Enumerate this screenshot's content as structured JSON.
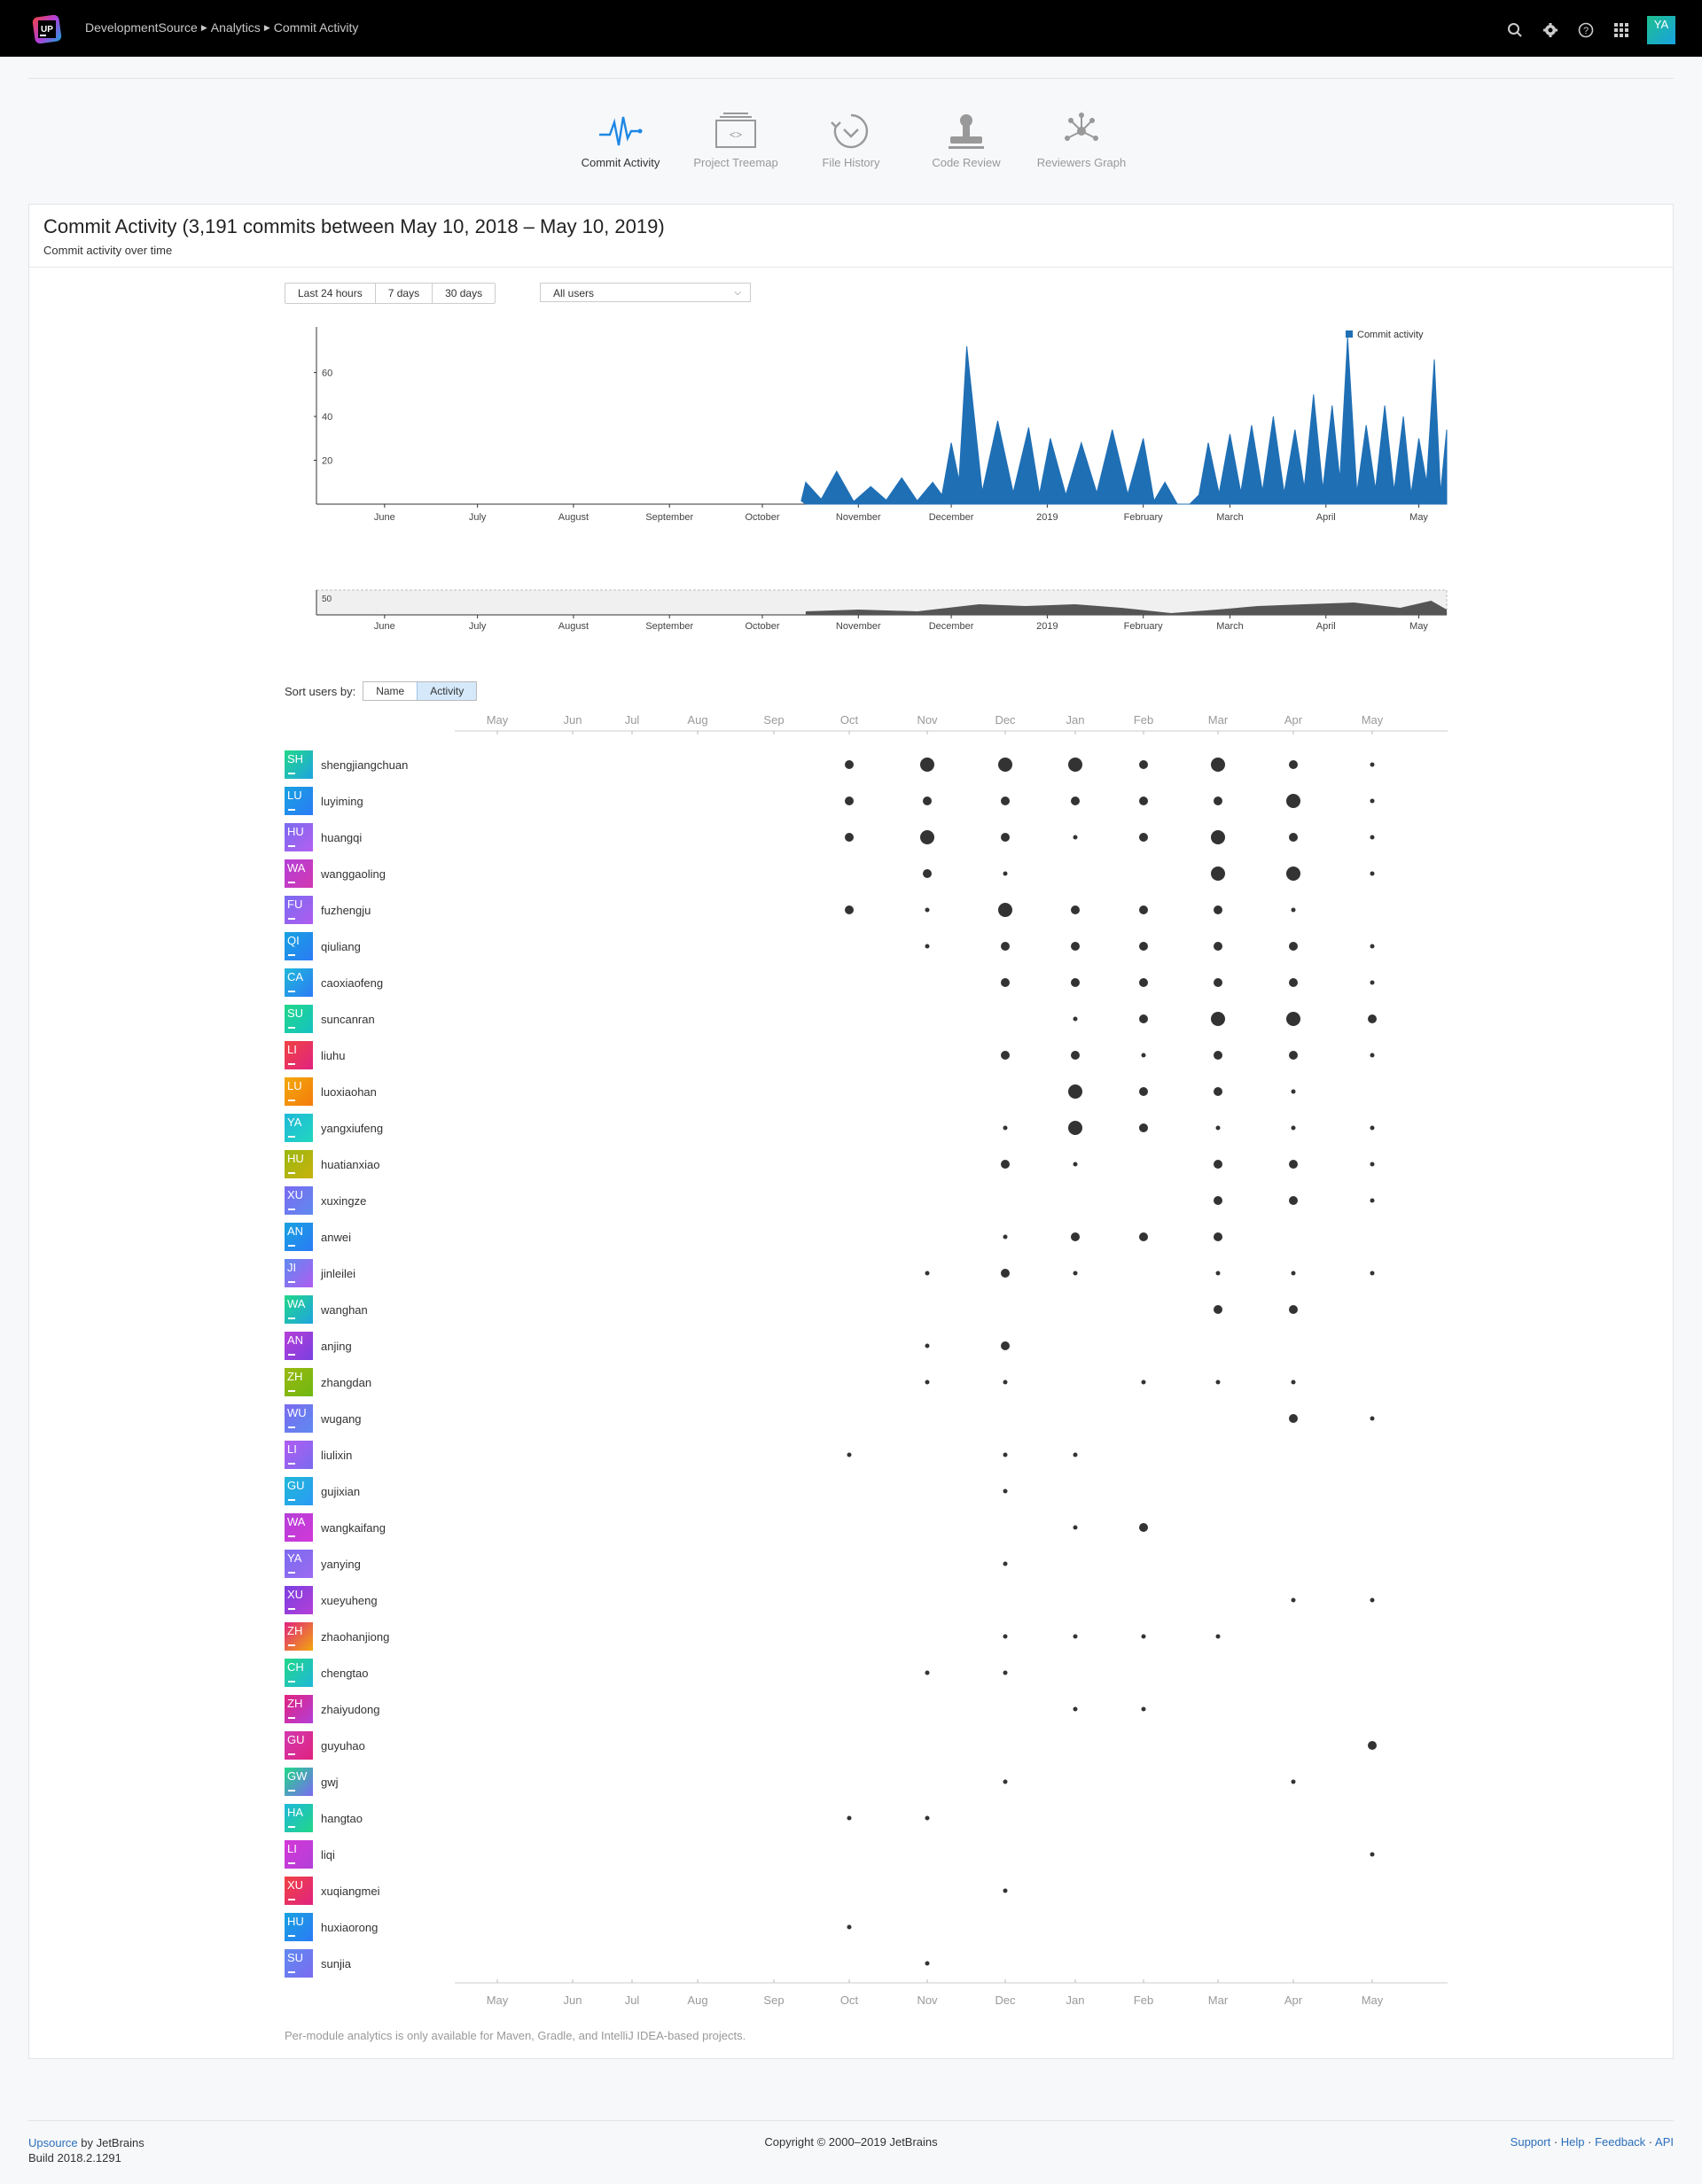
{
  "topbar": {
    "logo": "UP",
    "breadcrumb": [
      "DevelopmentSource",
      "Analytics",
      "Commit Activity"
    ],
    "icons": [
      "search-icon",
      "settings-icon",
      "help-icon",
      "apps-grid-icon"
    ],
    "user_avatar": "YA"
  },
  "tools": [
    {
      "label": "Commit Activity",
      "icon": "pulse-icon",
      "active": true
    },
    {
      "label": "Project Treemap",
      "icon": "treemap-icon",
      "active": false
    },
    {
      "label": "File History",
      "icon": "history-icon",
      "active": false
    },
    {
      "label": "Code Review",
      "icon": "stamp-icon",
      "active": false
    },
    {
      "label": "Reviewers Graph",
      "icon": "graph-icon",
      "active": false
    }
  ],
  "card": {
    "title": "Commit Activity (3,191 commits between May 10, 2018 – May 10, 2019)",
    "subtitle": "Commit activity over time",
    "ranges": [
      "Last 24 hours",
      "7 days",
      "30 days"
    ],
    "user_filter": "All users"
  },
  "chart_data": [
    {
      "type": "area",
      "legend": "Commit activity",
      "legend_position": "top-right",
      "yticks": [
        20,
        40,
        60
      ],
      "ylim": [
        0,
        78
      ],
      "x_labels": [
        "June",
        "July",
        "August",
        "September",
        "October",
        "November",
        "December",
        "2019",
        "February",
        "March",
        "April",
        "May"
      ],
      "x_range": [
        "2018-05-10",
        "2019-05-10"
      ],
      "x": [
        "2018-10-15",
        "2018-10-25",
        "2018-11-05",
        "2018-11-15",
        "2018-11-25",
        "2018-12-01",
        "2018-12-06",
        "2018-12-16",
        "2018-12-26",
        "2019-01-02",
        "2019-01-12",
        "2019-01-22",
        "2019-02-01",
        "2019-02-08",
        "2019-02-16",
        "2019-02-22",
        "2019-03-01",
        "2019-03-08",
        "2019-03-15",
        "2019-03-22",
        "2019-03-28",
        "2019-04-03",
        "2019-04-08",
        "2019-04-14",
        "2019-04-20",
        "2019-04-26",
        "2019-05-01",
        "2019-05-06",
        "2019-05-10"
      ],
      "values": [
        10,
        15,
        8,
        12,
        10,
        28,
        72,
        38,
        35,
        30,
        28,
        34,
        30,
        10,
        0,
        28,
        32,
        36,
        40,
        34,
        50,
        45,
        76,
        36,
        45,
        40,
        30,
        66,
        34
      ],
      "grid": false
    },
    {
      "type": "area",
      "role": "overview",
      "yticks": [
        50
      ],
      "x_labels": [
        "June",
        "July",
        "August",
        "September",
        "October",
        "November",
        "December",
        "2019",
        "February",
        "March",
        "April",
        "May"
      ],
      "x": [
        "2018-10-15",
        "2018-11-01",
        "2018-11-20",
        "2018-12-10",
        "2018-12-25",
        "2019-01-10",
        "2019-01-25",
        "2019-02-10",
        "2019-02-25",
        "2019-03-10",
        "2019-03-25",
        "2019-04-10",
        "2019-04-25",
        "2019-05-05",
        "2019-05-10"
      ],
      "values": [
        2,
        3,
        2,
        6,
        5,
        6,
        4,
        1,
        3,
        5,
        6,
        7,
        4,
        8,
        3
      ]
    },
    {
      "type": "scatter",
      "role": "per-user bubbles",
      "months": [
        "May",
        "Jun",
        "Jul",
        "Aug",
        "Sep",
        "Oct",
        "Nov",
        "Dec",
        "Jan",
        "Feb",
        "Mar",
        "Apr",
        "May"
      ]
    }
  ],
  "sort": {
    "label": "Sort users by:",
    "options": [
      "Name",
      "Activity"
    ],
    "selected": "Activity"
  },
  "users": [
    {
      "initials": "SH",
      "name": "shengjiangchuan",
      "color": [
        "#21d789",
        "#1fa4e0"
      ],
      "dots": [
        0,
        0,
        0,
        0,
        0,
        2,
        3,
        3,
        3,
        2,
        3,
        2,
        1
      ]
    },
    {
      "initials": "LU",
      "name": "luyiming",
      "color": [
        "#17a2e0",
        "#2b7bf5"
      ],
      "dots": [
        0,
        0,
        0,
        0,
        0,
        2,
        2,
        2,
        2,
        2,
        2,
        3,
        1
      ]
    },
    {
      "initials": "HU",
      "name": "huangqi",
      "color": [
        "#7a6bf0",
        "#b45ff0"
      ],
      "dots": [
        0,
        0,
        0,
        0,
        0,
        2,
        3,
        2,
        1,
        2,
        3,
        2,
        1
      ]
    },
    {
      "initials": "WA",
      "name": "wanggaoling",
      "color": [
        "#b43fd8",
        "#d238b0"
      ],
      "dots": [
        0,
        0,
        0,
        0,
        0,
        0,
        2,
        1,
        0,
        0,
        3,
        3,
        1
      ]
    },
    {
      "initials": "FU",
      "name": "fuzhengju",
      "color": [
        "#7a6bf0",
        "#b05cf0"
      ],
      "dots": [
        0,
        0,
        0,
        0,
        0,
        2,
        1,
        3,
        2,
        2,
        2,
        1,
        0
      ]
    },
    {
      "initials": "QI",
      "name": "qiuliang",
      "color": [
        "#17a2e0",
        "#2b7bf5"
      ],
      "dots": [
        0,
        0,
        0,
        0,
        0,
        0,
        1,
        2,
        2,
        2,
        2,
        2,
        1
      ]
    },
    {
      "initials": "CA",
      "name": "caoxiaofeng",
      "color": [
        "#1fb8d8",
        "#2b7bf5"
      ],
      "dots": [
        0,
        0,
        0,
        0,
        0,
        0,
        0,
        2,
        2,
        2,
        2,
        2,
        1
      ]
    },
    {
      "initials": "SU",
      "name": "suncanran",
      "color": [
        "#21d789",
        "#16c2c2"
      ],
      "dots": [
        0,
        0,
        0,
        0,
        0,
        0,
        0,
        0,
        1,
        2,
        3,
        3,
        2
      ]
    },
    {
      "initials": "LI",
      "name": "liuhu",
      "color": [
        "#f04343",
        "#e0237f"
      ],
      "dots": [
        0,
        0,
        0,
        0,
        0,
        0,
        0,
        2,
        2,
        1,
        2,
        2,
        1
      ]
    },
    {
      "initials": "LU",
      "name": "luoxiaohan",
      "color": [
        "#f2a80c",
        "#f57c0c"
      ],
      "dots": [
        0,
        0,
        0,
        0,
        0,
        0,
        0,
        0,
        3,
        2,
        2,
        1,
        0
      ]
    },
    {
      "initials": "YA",
      "name": "yangxiufeng",
      "color": [
        "#1fb8d8",
        "#21d7c0"
      ],
      "dots": [
        0,
        0,
        0,
        0,
        0,
        0,
        0,
        1,
        3,
        2,
        1,
        1,
        1
      ]
    },
    {
      "initials": "HU",
      "name": "huatianxiao",
      "color": [
        "#9ab810",
        "#c8b20c"
      ],
      "dots": [
        0,
        0,
        0,
        0,
        0,
        0,
        0,
        2,
        1,
        0,
        2,
        2,
        1
      ]
    },
    {
      "initials": "XU",
      "name": "xuxingze",
      "color": [
        "#7a6bf0",
        "#5f8af0"
      ],
      "dots": [
        0,
        0,
        0,
        0,
        0,
        0,
        0,
        0,
        0,
        0,
        2,
        2,
        1
      ]
    },
    {
      "initials": "AN",
      "name": "anwei",
      "color": [
        "#17a2e0",
        "#2b7bf5"
      ],
      "dots": [
        0,
        0,
        0,
        0,
        0,
        0,
        0,
        1,
        2,
        2,
        2,
        0,
        0
      ]
    },
    {
      "initials": "JI",
      "name": "jinleilei",
      "color": [
        "#5f8af0",
        "#b05cf0"
      ],
      "dots": [
        0,
        0,
        0,
        0,
        0,
        0,
        1,
        2,
        1,
        0,
        1,
        1,
        1
      ]
    },
    {
      "initials": "WA",
      "name": "wanghan",
      "color": [
        "#21d789",
        "#1fa4e0"
      ],
      "dots": [
        0,
        0,
        0,
        0,
        0,
        0,
        0,
        0,
        0,
        0,
        2,
        2,
        0
      ]
    },
    {
      "initials": "AN",
      "name": "anjing",
      "color": [
        "#b43fd8",
        "#7a3fe0"
      ],
      "dots": [
        0,
        0,
        0,
        0,
        0,
        0,
        1,
        2,
        0,
        0,
        0,
        0,
        0
      ]
    },
    {
      "initials": "ZH",
      "name": "zhangdan",
      "color": [
        "#9ab810",
        "#6fb810"
      ],
      "dots": [
        0,
        0,
        0,
        0,
        0,
        0,
        1,
        1,
        0,
        1,
        1,
        1,
        0
      ]
    },
    {
      "initials": "WU",
      "name": "wugang",
      "color": [
        "#7a6bf0",
        "#5f8af0"
      ],
      "dots": [
        0,
        0,
        0,
        0,
        0,
        0,
        0,
        0,
        0,
        0,
        0,
        2,
        1
      ]
    },
    {
      "initials": "LI",
      "name": "liulixin",
      "color": [
        "#b05cf0",
        "#7a6bf0"
      ],
      "dots": [
        0,
        0,
        0,
        0,
        0,
        1,
        0,
        1,
        1,
        0,
        0,
        0,
        0
      ]
    },
    {
      "initials": "GU",
      "name": "gujixian",
      "color": [
        "#1fb8d8",
        "#2b9bf5"
      ],
      "dots": [
        0,
        0,
        0,
        0,
        0,
        0,
        0,
        1,
        0,
        0,
        0,
        0,
        0
      ]
    },
    {
      "initials": "WA",
      "name": "wangkaifang",
      "color": [
        "#b43fd8",
        "#d238d8"
      ],
      "dots": [
        0,
        0,
        0,
        0,
        0,
        0,
        0,
        0,
        1,
        2,
        0,
        0,
        0
      ]
    },
    {
      "initials": "YA",
      "name": "yanying",
      "color": [
        "#7a6bf0",
        "#9b6bf0"
      ],
      "dots": [
        0,
        0,
        0,
        0,
        0,
        0,
        0,
        1,
        0,
        0,
        0,
        0,
        0
      ]
    },
    {
      "initials": "XU",
      "name": "xueyuheng",
      "color": [
        "#7a3fe0",
        "#b43fd8"
      ],
      "dots": [
        0,
        0,
        0,
        0,
        0,
        0,
        0,
        0,
        0,
        0,
        0,
        1,
        1
      ]
    },
    {
      "initials": "ZH",
      "name": "zhaohanjiong",
      "color": [
        "#e0237f",
        "#f2a80c"
      ],
      "dots": [
        0,
        0,
        0,
        0,
        0,
        0,
        0,
        1,
        1,
        1,
        1,
        0,
        0
      ]
    },
    {
      "initials": "CH",
      "name": "chengtao",
      "color": [
        "#21d789",
        "#1fb8d8"
      ],
      "dots": [
        0,
        0,
        0,
        0,
        0,
        0,
        1,
        1,
        0,
        0,
        0,
        0,
        0
      ]
    },
    {
      "initials": "ZH",
      "name": "zhaiyudong",
      "color": [
        "#e0237f",
        "#b43fd8"
      ],
      "dots": [
        0,
        0,
        0,
        0,
        0,
        0,
        0,
        0,
        1,
        1,
        0,
        0,
        0
      ]
    },
    {
      "initials": "GU",
      "name": "guyuhao",
      "color": [
        "#d238b0",
        "#e0237f"
      ],
      "dots": [
        0,
        0,
        0,
        0,
        0,
        0,
        0,
        0,
        0,
        0,
        0,
        0,
        2
      ]
    },
    {
      "initials": "GW",
      "name": "gwj",
      "color": [
        "#21d789",
        "#7a6bf0"
      ],
      "dots": [
        0,
        0,
        0,
        0,
        0,
        0,
        0,
        1,
        0,
        0,
        0,
        1,
        0
      ]
    },
    {
      "initials": "HA",
      "name": "hangtao",
      "color": [
        "#1fb8d8",
        "#21d789"
      ],
      "dots": [
        0,
        0,
        0,
        0,
        0,
        1,
        1,
        0,
        0,
        0,
        0,
        0,
        0
      ]
    },
    {
      "initials": "LI",
      "name": "liqi",
      "color": [
        "#d238d8",
        "#b43fd8"
      ],
      "dots": [
        0,
        0,
        0,
        0,
        0,
        0,
        0,
        0,
        0,
        0,
        0,
        0,
        1
      ]
    },
    {
      "initials": "XU",
      "name": "xuqiangmei",
      "color": [
        "#f04343",
        "#e0237f"
      ],
      "dots": [
        0,
        0,
        0,
        0,
        0,
        0,
        0,
        1,
        0,
        0,
        0,
        0,
        0
      ]
    },
    {
      "initials": "HU",
      "name": "huxiaorong",
      "color": [
        "#17a2e0",
        "#2b7bf5"
      ],
      "dots": [
        0,
        0,
        0,
        0,
        0,
        1,
        0,
        0,
        0,
        0,
        0,
        0,
        0
      ]
    },
    {
      "initials": "SU",
      "name": "sunjia",
      "color": [
        "#5f8af0",
        "#7a6bf0"
      ],
      "dots": [
        0,
        0,
        0,
        0,
        0,
        0,
        1,
        0,
        0,
        0,
        0,
        0,
        0
      ]
    }
  ],
  "note": "Per-module analytics is only available for Maven, Gradle, and IntelliJ IDEA-based projects.",
  "footer": {
    "brand_link": "Upsource",
    "brand_rest": " by JetBrains",
    "build": "Build 2018.2.1291",
    "copyright": "Copyright © 2000–2019 JetBrains",
    "links": [
      "Support",
      "Help",
      "Feedback",
      "API"
    ]
  }
}
